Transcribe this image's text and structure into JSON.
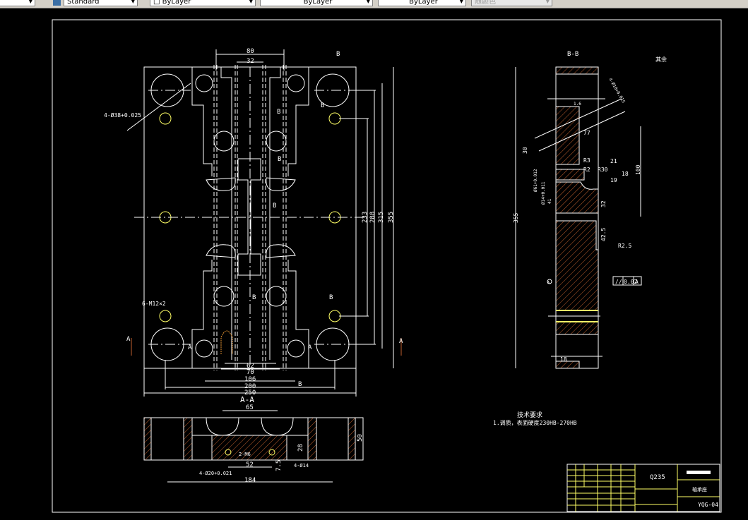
{
  "toolbar": {
    "text_style": "Standard",
    "layer": "ByLayer",
    "linetype": "ByLayer",
    "lineweight": "ByLayer",
    "plot_style": "随颜色"
  },
  "colors": {
    "background": "#000000",
    "lines": "#ffffff",
    "hatch": "#c0602e",
    "highlight": "#ffff66",
    "title_block": "#ffff66"
  },
  "drawing": {
    "main_view": {
      "dims": [
        "80",
        "32",
        "233",
        "288",
        "315",
        "355",
        "62",
        "70",
        "106",
        "200",
        "250"
      ],
      "notes": [
        "4-Ø38+0.025",
        "6-M12×2",
        "A",
        "A",
        "B",
        "B",
        "B",
        "B",
        "B",
        "B",
        "B",
        "B",
        "A",
        "A"
      ]
    },
    "section_aa": {
      "title": "A-A",
      "dims": [
        "65",
        "52",
        "184",
        "28",
        "50",
        "7.5",
        "4-Ø14",
        "2-M6",
        "4-Ø20+0.021"
      ]
    },
    "section_bb": {
      "title": "B-B",
      "roughness_note": "其余",
      "dims": [
        "355",
        "30",
        "100",
        "77",
        "21",
        "18",
        "19",
        "32",
        "42.5",
        "R2.5",
        "R3",
        "R2",
        "R30",
        "18",
        "1.6",
        "Ø61+0.012",
        "Ø14+0.011",
        "41",
        "4-Ø10+0.015"
      ],
      "tolerance": {
        "symbol": "//",
        "value": "0.02",
        "datum": "A"
      },
      "datum_label": "A"
    },
    "tech_requirements": {
      "title": "技术要求",
      "items": [
        "1.调质，表面硬度230HB-270HB"
      ]
    },
    "title_block": {
      "material": "Q235",
      "part_name": "轴承座",
      "drawing_number": "YQG-04"
    }
  }
}
